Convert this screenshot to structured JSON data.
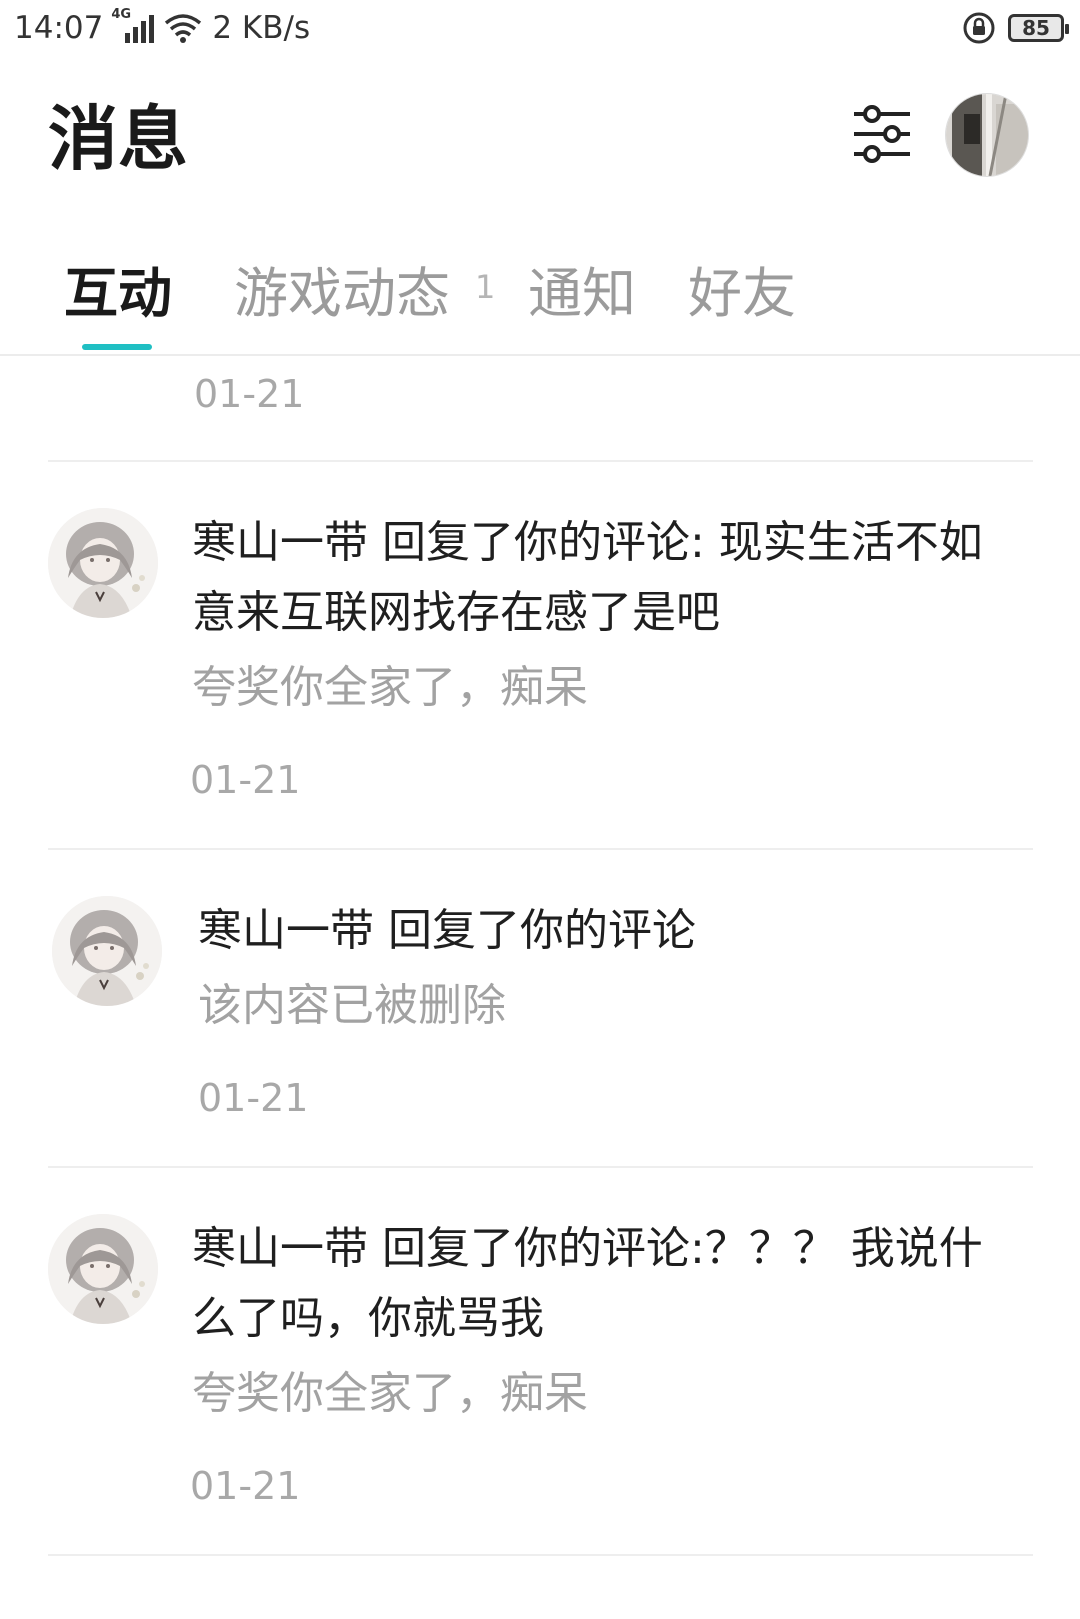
{
  "status_bar": {
    "time": "14:07",
    "network": "4G",
    "speed": "2 KB/s",
    "battery": "85"
  },
  "header": {
    "title": "消息"
  },
  "tabs": [
    {
      "label": "互动",
      "active": true
    },
    {
      "label": "游戏动态",
      "badge": "1"
    },
    {
      "label": "通知"
    },
    {
      "label": "好友"
    }
  ],
  "colors": {
    "accent": "#1fbfc3",
    "primary_text": "#1f1f1f",
    "secondary_text": "#a2a2a2"
  },
  "messages": {
    "partial_date": "01-21",
    "items": [
      {
        "reply": "寒山一带 回复了你的评论: 现实生活不如意来互联网找存在感了是吧",
        "quote": "夸奖你全家了，痴呆",
        "date": "01-21"
      },
      {
        "reply": "寒山一带 回复了你的评论",
        "quote": "该内容已被删除",
        "date": "01-21"
      },
      {
        "reply": "寒山一带 回复了你的评论:？？？ 我说什么了吗，你就骂我",
        "quote": "夸奖你全家了，痴呆",
        "date": "01-21"
      }
    ]
  }
}
